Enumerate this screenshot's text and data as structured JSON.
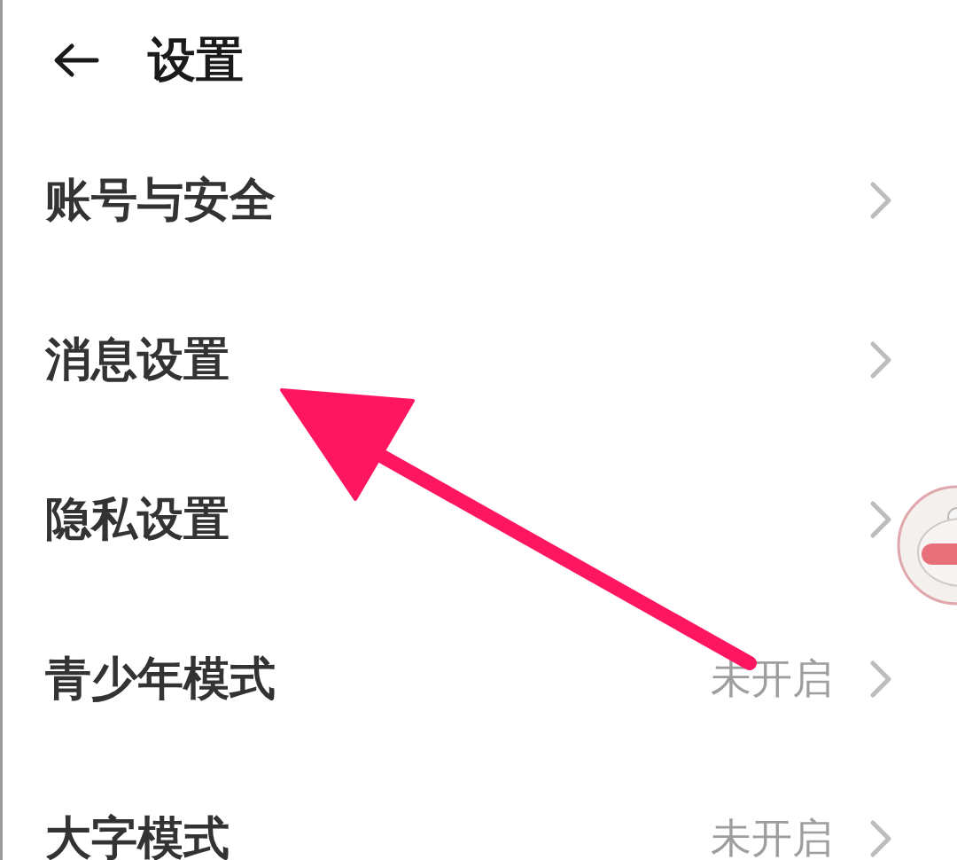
{
  "header": {
    "title": "设置"
  },
  "items": [
    {
      "label": "账号与安全"
    },
    {
      "label": "消息设置"
    },
    {
      "label": "隐私设置"
    },
    {
      "label": "青少年模式",
      "value": "未开启"
    },
    {
      "label": "大字模式",
      "value": "未开启"
    }
  ]
}
